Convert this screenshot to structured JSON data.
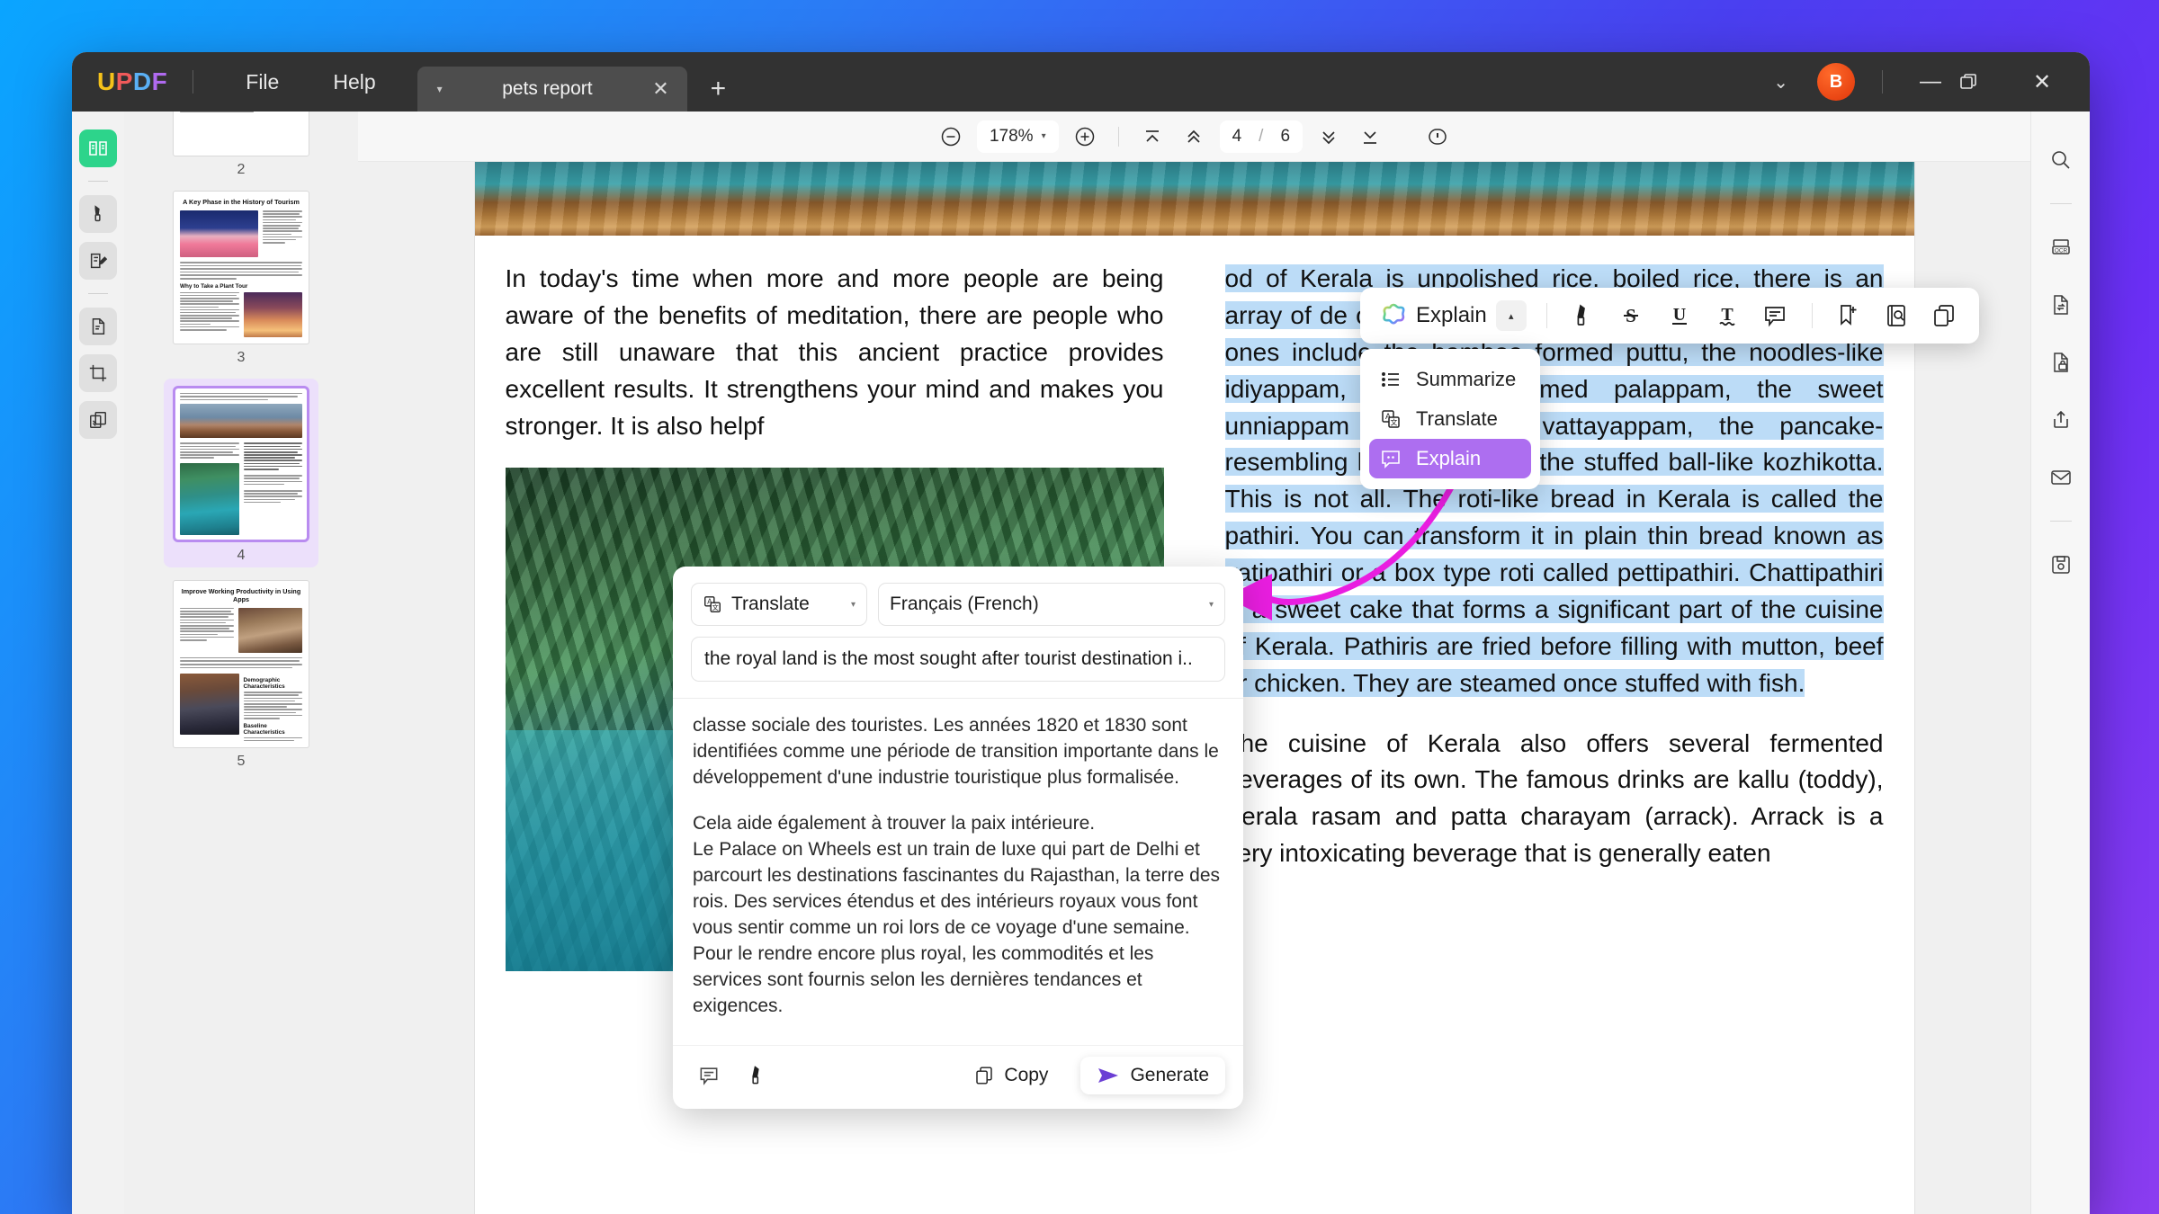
{
  "titlebar": {
    "logo": [
      "U",
      "P",
      "D",
      "F"
    ],
    "menus": [
      "File",
      "Help"
    ],
    "tab_title": "pets report",
    "tab_close": "✕",
    "new_tab": "+",
    "chevron": "⌄",
    "avatar_initial": "B",
    "minimize": "—",
    "maximize": "❐",
    "close": "✕"
  },
  "left_rail": {
    "items": [
      {
        "name": "reader-mode",
        "active": true
      },
      {
        "name": "comment-highlight",
        "active": false
      },
      {
        "name": "edit-pdf",
        "active": false
      },
      {
        "name": "page-organize",
        "active": false
      },
      {
        "name": "crop-page",
        "active": false
      },
      {
        "name": "batch-process",
        "active": false
      }
    ]
  },
  "right_rail": {
    "items": [
      "search-icon",
      "ocr-icon",
      "convert-icon",
      "protect-icon",
      "share-icon",
      "email-icon",
      "save-icon"
    ]
  },
  "viewer_toolbar": {
    "zoom_out": "−",
    "zoom_level": "178%",
    "zoom_caret": "▾",
    "zoom_in": "+",
    "first_page": "first-page-icon",
    "prev_page": "prev-page-icon",
    "current_page": "4",
    "slash": "/",
    "total_pages": "6",
    "next_page": "next-page-icon",
    "last_page": "last-page-icon",
    "view_mode": "continuous-scroll-icon"
  },
  "thumbnails": [
    {
      "number": "2",
      "title": "",
      "selected": false
    },
    {
      "number": "3",
      "title": "A Key Phase in the History of Tourism",
      "subtitle": "Why to Take a Plant Tour",
      "selected": false
    },
    {
      "number": "4",
      "title": "",
      "selected": true
    },
    {
      "number": "5",
      "title": "Improve Working Productivity in Using Apps",
      "subtitle": "Demographic Characteristics",
      "subtitle2": "Baseline Characteristics",
      "selected": false
    }
  ],
  "document": {
    "left_paragraph": "In today's time when more and more people are being aware of the benefits of meditation, there are people who are still unaware that this ancient practice provides excellent results. It strengthens your mind and makes you stronger. It is also helpf",
    "right_highlighted": "od of Kerala is unpolished rice. boiled rice, there is an array of de of cereal that Keralites consume. The common ones include the bamboo formed puttu, the noodles-like idiyappam, the lace rimmed palappam, the sweet unniappam the spongy vattayappam, the pancake-resembling kallappam, and the stuffed ball-like kozhikotta. This is not all. The roti-like bread in Kerala is called the pathiri. You can transform it in plain thin bread known as vatipathiri or a box type roti called pettipathiri. Chattipathiri is a sweet cake that forms a significant part of the cuisine of Kerala. Pathiris are fried before filling with mutton, beef or chicken. They are steamed once stuffed with fish.",
    "right_paragraph2": "The cuisine of Kerala also offers several fermented beverages of its own. The famous drinks are kallu (toddy), Kerala rasam and patta charayam (arrack). Arrack is a very intoxicating beverage that is generally eaten",
    "highlight_color": "#bcdcf7"
  },
  "annotate_toolbar": {
    "explain_label": "Explain",
    "explain_caret": "▴",
    "icons": [
      "highlighter-icon",
      "strikethrough-icon",
      "underline-icon",
      "squiggly-underline-icon",
      "comment-icon",
      "bookmark-add-icon",
      "search-document-icon",
      "copy-icon"
    ]
  },
  "ai_menu": {
    "items": [
      {
        "label": "Summarize",
        "icon": "list-icon",
        "active": false
      },
      {
        "label": "Translate",
        "icon": "translate-icon",
        "active": false
      },
      {
        "label": "Explain",
        "icon": "explain-chat-icon",
        "active": true
      }
    ],
    "active_color": "#ad6ef0"
  },
  "translate_panel": {
    "mode_label": "Translate",
    "mode_caret": "▾",
    "language_label": "Français (French)",
    "language_caret": "▾",
    "source_text": "the royal land is the most sought after tourist destination i..",
    "result_paragraphs": [
      "classe sociale des touristes. Les années 1820 et 1830 sont identifiées comme une période de transition importante dans le développement d'une industrie touristique plus formalisée.",
      "Cela aide également à trouver la paix intérieure.\nLe Palace on Wheels est un train de luxe qui part de Delhi et parcourt les destinations fascinantes du Rajasthan, la terre des rois. Des services étendus et des intérieurs royaux vous font vous sentir comme un roi lors de ce voyage d'une semaine. Pour le rendre encore plus royal, les commodités et les services sont fournis selon les dernières tendances et exigences."
    ],
    "footer_icons": [
      "comment-icon",
      "highlighter-icon"
    ],
    "copy_label": "Copy",
    "generate_label": "Generate",
    "generate_accent": "#6b3fd4"
  },
  "annotation_arrow": {
    "name": "magenta-curved-arrow",
    "color": "#e91ee0"
  }
}
